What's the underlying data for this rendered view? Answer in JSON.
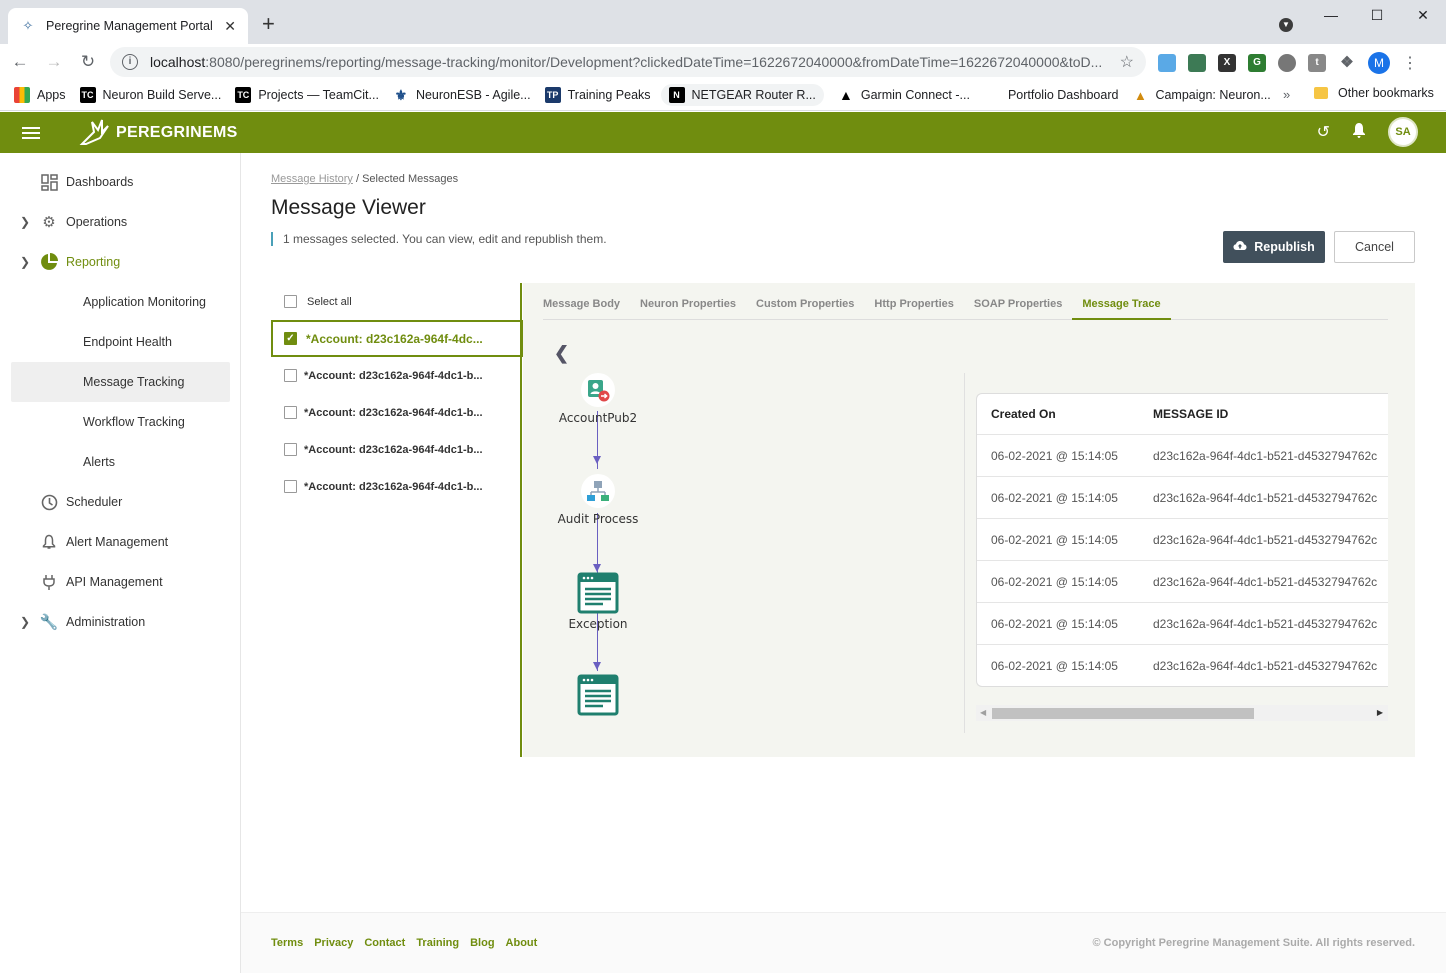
{
  "browser": {
    "tab_title": "Peregrine Management Portal",
    "url_host": "localhost",
    "url_rest": ":8080/peregrinems/reporting/message-tracking/monitor/Development?clickedDateTime=1622672040000&fromDateTime=1622672040000&toD...",
    "profile_initial": "M",
    "bookmarks": [
      {
        "label": "Apps",
        "icon": "apps-grid-icon"
      },
      {
        "label": "Neuron Build Serve...",
        "icon": "teamcity-icon"
      },
      {
        "label": "Projects — TeamCit...",
        "icon": "teamcity-icon"
      },
      {
        "label": "NeuronESB - Agile...",
        "icon": "agile-icon"
      },
      {
        "label": "Training Peaks",
        "icon": "trainingpeaks-icon"
      },
      {
        "label": "NETGEAR Router R...",
        "icon": "netgear-icon"
      },
      {
        "label": "Garmin Connect -...",
        "icon": "garmin-icon"
      },
      {
        "label": "Portfolio Dashboard",
        "icon": "none"
      },
      {
        "label": "Campaign: Neuron...",
        "icon": "dynamics-icon"
      }
    ],
    "other_bookmarks": "Other bookmarks"
  },
  "app": {
    "brand": "PEREGRINEMS",
    "user_initials": "SA",
    "colors": {
      "primary": "#708d0f",
      "dark_button": "#41505c"
    }
  },
  "sidebar": {
    "items": [
      {
        "label": "Dashboards"
      },
      {
        "label": "Operations"
      },
      {
        "label": "Reporting"
      },
      {
        "label": "Application Monitoring"
      },
      {
        "label": "Endpoint Health"
      },
      {
        "label": "Message Tracking"
      },
      {
        "label": "Workflow Tracking"
      },
      {
        "label": "Alerts"
      },
      {
        "label": "Scheduler"
      },
      {
        "label": "Alert Management"
      },
      {
        "label": "API Management"
      },
      {
        "label": "Administration"
      }
    ]
  },
  "page": {
    "breadcrumb_link": "Message History",
    "breadcrumb_sep": " / ",
    "breadcrumb_current": "Selected Messages",
    "title": "Message Viewer",
    "subtitle": "1 messages selected. You can view, edit and republish them.",
    "republish_label": "Republish",
    "cancel_label": "Cancel"
  },
  "messages": {
    "select_all": "Select all",
    "items": [
      {
        "label": "*Account: d23c162a-964f-4dc...",
        "selected": true
      },
      {
        "label": "*Account: d23c162a-964f-4dc1-b...",
        "selected": false
      },
      {
        "label": "*Account: d23c162a-964f-4dc1-b...",
        "selected": false
      },
      {
        "label": "*Account: d23c162a-964f-4dc1-b...",
        "selected": false
      },
      {
        "label": "*Account: d23c162a-964f-4dc1-b...",
        "selected": false
      }
    ]
  },
  "tabs": [
    "Message Body",
    "Neuron Properties",
    "Custom Properties",
    "Http Properties",
    "SOAP Properties",
    "Message Trace"
  ],
  "active_tab": "Message Trace",
  "flow": {
    "nodes": [
      "AccountPub2",
      "Audit Process",
      "Exception",
      ""
    ]
  },
  "trace_table": {
    "headers": [
      "Created On",
      "MESSAGE ID"
    ],
    "rows": [
      [
        "06-02-2021 @ 15:14:05",
        "d23c162a-964f-4dc1-b521-d4532794762c"
      ],
      [
        "06-02-2021 @ 15:14:05",
        "d23c162a-964f-4dc1-b521-d4532794762c"
      ],
      [
        "06-02-2021 @ 15:14:05",
        "d23c162a-964f-4dc1-b521-d4532794762c"
      ],
      [
        "06-02-2021 @ 15:14:05",
        "d23c162a-964f-4dc1-b521-d4532794762c"
      ],
      [
        "06-02-2021 @ 15:14:05",
        "d23c162a-964f-4dc1-b521-d4532794762c"
      ],
      [
        "06-02-2021 @ 15:14:05",
        "d23c162a-964f-4dc1-b521-d4532794762c"
      ]
    ]
  },
  "footer": {
    "links": [
      "Terms",
      "Privacy",
      "Contact",
      "Training",
      "Blog",
      "About"
    ],
    "copyright": "© Copyright Peregrine Management Suite. All rights reserved."
  }
}
